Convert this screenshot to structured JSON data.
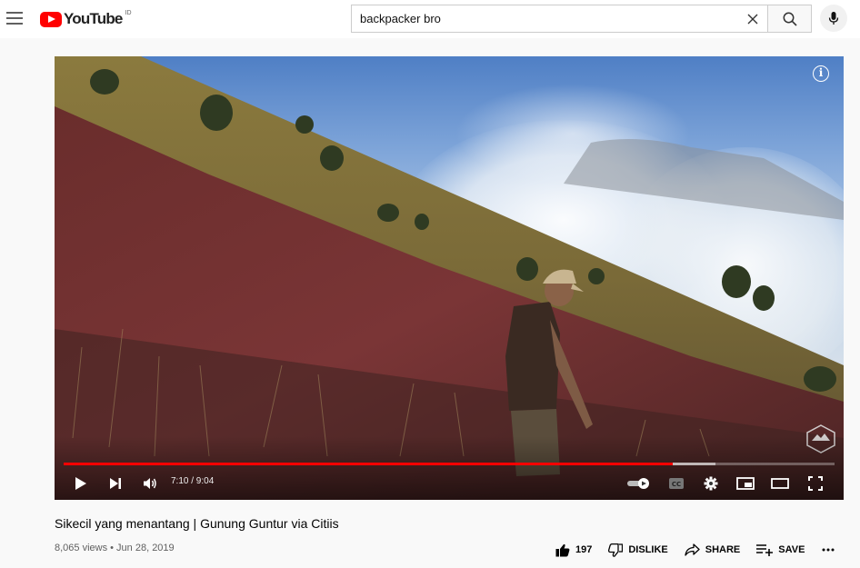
{
  "header": {
    "logo_text": "YouTube",
    "country_code": "ID",
    "search_value": "backpacker bro"
  },
  "player": {
    "current_time": "7:10",
    "duration": "9:04",
    "time_display": "7:10 / 9:04",
    "progress_fraction": 0.79,
    "buffered_fraction": 0.845,
    "colors": {
      "progress": "#ff0000"
    }
  },
  "video": {
    "title": "Sikecil yang menantang | Gunung Guntur via Citiis",
    "meta": "8,065 views • Jun 28, 2019"
  },
  "actions": {
    "like_count": "197",
    "dislike_label": "DISLIKE",
    "share_label": "SHARE",
    "save_label": "SAVE"
  }
}
